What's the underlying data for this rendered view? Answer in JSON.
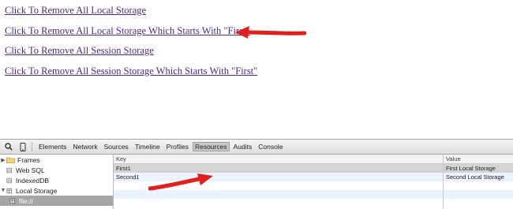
{
  "links": [
    "Click To Remove All Local Storage",
    "Click To Remove All Local Storage Which Starts With \"First\"",
    "Click To Remove All Session Storage",
    "Click To Remove All Session Storage Which Starts With \"First\""
  ],
  "devtools": {
    "tabs": [
      "Elements",
      "Network",
      "Sources",
      "Timeline",
      "Profiles",
      "Resources",
      "Audits",
      "Console"
    ],
    "selected_tab": "Resources",
    "sidebar": [
      "Frames",
      "Web SQL",
      "IndexedDB",
      "Local Storage",
      "file://"
    ],
    "table": {
      "headers": [
        "Key",
        "Value"
      ],
      "rows": [
        {
          "key": "First1",
          "value": "First Local Storage"
        },
        {
          "key": "Second1",
          "value": "Second Local Storage"
        }
      ]
    }
  },
  "colors": {
    "link": "#4b2a8a",
    "arrow": "#e0201c",
    "selected_row": "#d4d4d4",
    "alt_row": "#eaf3ff"
  },
  "icons": [
    "search-icon",
    "device-icon",
    "folder-icon",
    "database-icon",
    "grid-icon",
    "red-arrow-icon"
  ]
}
